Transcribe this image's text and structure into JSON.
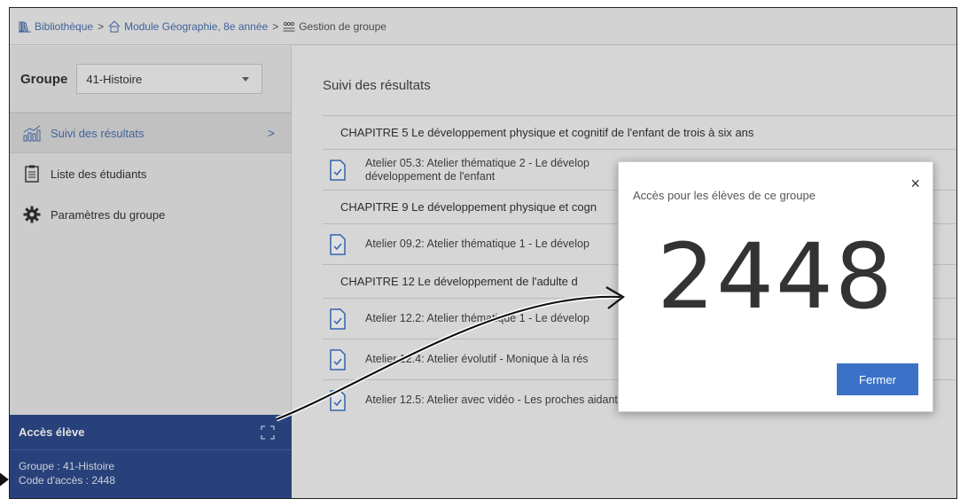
{
  "breadcrumb": {
    "items": [
      "Bibliothèque",
      "Module Géographie, 8e année",
      "Gestion de groupe"
    ],
    "separator": ">"
  },
  "sidebar": {
    "group_label": "Groupe",
    "group_value": "41-Histoire",
    "nav": [
      {
        "label": "Suivi des résultats",
        "icon": "chart-icon",
        "active": true
      },
      {
        "label": "Liste des étudiants",
        "icon": "list-icon",
        "active": false
      },
      {
        "label": "Paramètres du groupe",
        "icon": "gear-icon",
        "active": false
      }
    ],
    "chevron": ">"
  },
  "access": {
    "title": "Accès élève",
    "group_line": "Groupe : 41-Histoire",
    "code_line": "Code d'accès : 2448"
  },
  "main": {
    "title": "Suivi des résultats",
    "rows": [
      {
        "type": "chapter",
        "text": "CHAPITRE 5 Le développement physique et cognitif de l'enfant de trois à six ans"
      },
      {
        "type": "activity",
        "text": "Atelier 05.3: Atelier thématique 2 - Le dévelop",
        "text2": "développement de l'enfant"
      },
      {
        "type": "chapter",
        "text": "CHAPITRE 9 Le développement physique et cogn"
      },
      {
        "type": "activity",
        "text": "Atelier 09.2: Atelier thématique 1 - Le dévelop",
        "text2": ""
      },
      {
        "type": "chapter",
        "text": "CHAPITRE 12 Le développement de l'adulte d"
      },
      {
        "type": "activity",
        "text": "Atelier 12.2: Atelier thématique 1 - Le dévelop",
        "text2": ""
      },
      {
        "type": "activity",
        "text": "Atelier 12.4: Atelier évolutif - Monique à la rés",
        "text2": ""
      },
      {
        "type": "activity",
        "text": "Atelier 12.5: Atelier avec vidéo - Les proches aidants",
        "text2": ""
      }
    ]
  },
  "modal": {
    "title": "Accès pour les élèves de ce groupe",
    "close": "×",
    "code": "2448",
    "button": "Fermer"
  },
  "colors": {
    "accent": "#3b72c7",
    "panel": "#2e4a8c",
    "link": "#4a6fb0"
  }
}
